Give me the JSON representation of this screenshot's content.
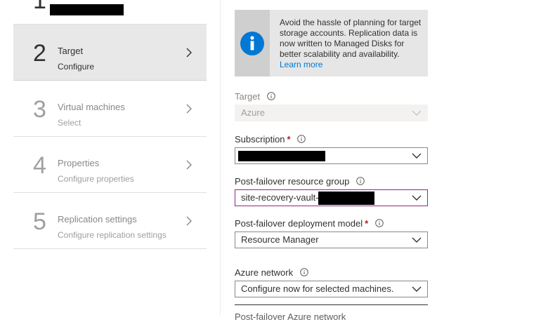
{
  "steps": [
    {
      "number": "1",
      "title": "",
      "subtitle": ""
    },
    {
      "number": "2",
      "title": "Target",
      "subtitle": "Configure"
    },
    {
      "number": "3",
      "title": "Virtual machines",
      "subtitle": "Select"
    },
    {
      "number": "4",
      "title": "Properties",
      "subtitle": "Configure properties"
    },
    {
      "number": "5",
      "title": "Replication settings",
      "subtitle": "Configure replication settings"
    }
  ],
  "banner": {
    "text": "Avoid the hassle of planning for target storage accounts. Replication data is now written to Managed Disks for better scalability and availability.",
    "link": "Learn more"
  },
  "form": {
    "target": {
      "label": "Target",
      "value": "Azure"
    },
    "subscription": {
      "label": "Subscription",
      "required_mark": "*",
      "value": ""
    },
    "resource_group": {
      "label": "Post-failover resource group",
      "value": "site-recovery-vault-"
    },
    "deployment_model": {
      "label": "Post-failover deployment model",
      "required_mark": "*",
      "value": "Resource Manager"
    },
    "azure_network": {
      "label": "Azure network",
      "value": "Configure now for selected machines."
    },
    "next_label": "Post-failover Azure network"
  },
  "colors": {
    "accent": "#0078d4",
    "required": "#a4262c",
    "focus": "#8a2a7e"
  }
}
